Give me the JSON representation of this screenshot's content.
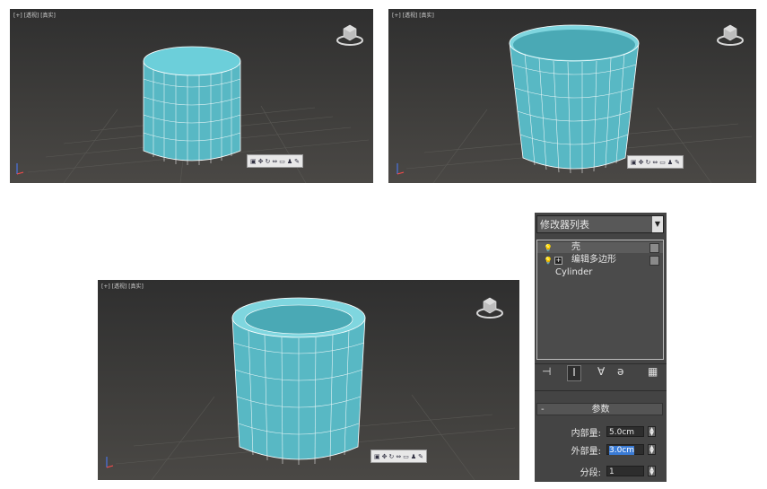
{
  "viewports": [
    {
      "label": "[+] [透视] [真实]"
    },
    {
      "label": "[+] [透视] [真实]"
    },
    {
      "label": "[+] [透视] [真实]"
    }
  ],
  "viewport_toolbar_icons": [
    "select-icon",
    "move-icon",
    "rotate-icon",
    "scale-icon",
    "camera-icon",
    "light-icon",
    "wrench-icon"
  ],
  "modifier_panel": {
    "dropdown_label": "修改器列表",
    "stack": [
      {
        "label": "壳"
      },
      {
        "label": "编辑多边形"
      },
      {
        "label": "Cylinder"
      }
    ],
    "parameters": {
      "rollout_title": "参数",
      "rollout_toggle": "-",
      "inner_label": "内部量:",
      "inner_value": "5.0cm",
      "outer_label": "外部量:",
      "outer_value": "3.0cm",
      "segments_label": "分段:",
      "segments_value": "1"
    }
  },
  "colors": {
    "mesh": "#5fbfca",
    "viewport_bg": "#3a3937",
    "panel_bg": "#444444",
    "selection": "#3a7bd5"
  }
}
